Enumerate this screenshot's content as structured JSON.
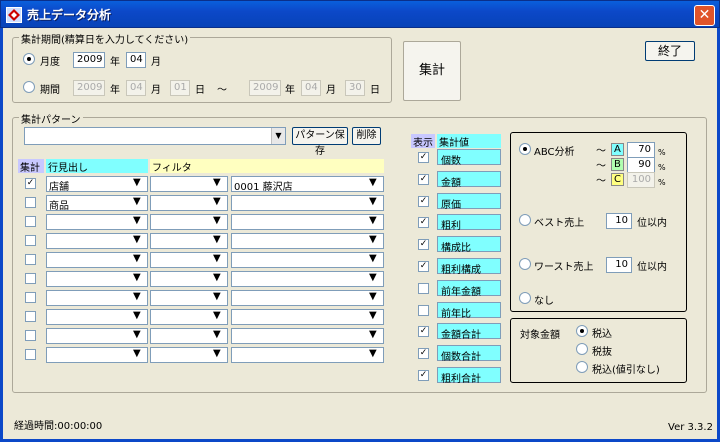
{
  "window": {
    "title": "売上データ分析",
    "close_label": "✕"
  },
  "period": {
    "legend": "集計期間(精算日を入力してください)",
    "monthly": {
      "label": "月度",
      "year": "2009",
      "year_unit": "年",
      "month": "04",
      "month_unit": "月"
    },
    "range": {
      "label": "期間",
      "from_year": "2009",
      "from_month": "04",
      "from_day": "01",
      "tilde": "〜",
      "to_year": "2009",
      "to_month": "04",
      "to_day": "30",
      "year_unit": "年",
      "month_unit": "月",
      "day_unit": "日"
    }
  },
  "aggregate_button": "集計",
  "exit_button": "終了",
  "pattern": {
    "legend": "集計パターン",
    "save_button": "パターン保存",
    "delete_button": "削除",
    "col_aggregate": "集計",
    "col_row_header": "行見出し",
    "col_filter": "フィルタ",
    "rows": [
      {
        "checked": true,
        "row": "店舗",
        "filter": "0001 藤沢店"
      },
      {
        "checked": false,
        "row": "商品",
        "filter": ""
      },
      {
        "checked": false,
        "row": "",
        "filter": ""
      },
      {
        "checked": false,
        "row": "",
        "filter": ""
      },
      {
        "checked": false,
        "row": "",
        "filter": ""
      },
      {
        "checked": false,
        "row": "",
        "filter": ""
      },
      {
        "checked": false,
        "row": "",
        "filter": ""
      },
      {
        "checked": false,
        "row": "",
        "filter": ""
      },
      {
        "checked": false,
        "row": "",
        "filter": ""
      },
      {
        "checked": false,
        "row": "",
        "filter": ""
      }
    ]
  },
  "metrics": {
    "col_display": "表示",
    "col_value": "集計値",
    "items": [
      {
        "checked": true,
        "label": "個数"
      },
      {
        "checked": true,
        "label": "金額"
      },
      {
        "checked": true,
        "label": "原価"
      },
      {
        "checked": true,
        "label": "粗利"
      },
      {
        "checked": true,
        "label": "構成比"
      },
      {
        "checked": true,
        "label": "粗利構成"
      },
      {
        "checked": false,
        "label": "前年金額"
      },
      {
        "checked": false,
        "label": "前年比"
      },
      {
        "checked": true,
        "label": "金額合計"
      },
      {
        "checked": true,
        "label": "個数合計"
      },
      {
        "checked": true,
        "label": "粗利合計"
      }
    ]
  },
  "analysis": {
    "abc": {
      "label": "ABC分析",
      "tilde": "〜",
      "a_label": "A",
      "a_value": "70",
      "b_label": "B",
      "b_value": "90",
      "c_label": "C",
      "c_value": "100",
      "unit": "%"
    },
    "best": {
      "label": "ベスト売上",
      "value": "10",
      "unit": "位以内"
    },
    "worst": {
      "label": "ワースト売上",
      "value": "10",
      "unit": "位以内"
    },
    "none": {
      "label": "なし"
    }
  },
  "amount": {
    "label": "対象金額",
    "options": [
      "税込",
      "税抜",
      "税込(値引なし)"
    ]
  },
  "status": {
    "elapsed": "経過時間:00:00:00",
    "version": "Ver 3.3.2"
  },
  "colors": {
    "title_bar": "#0c48c8",
    "header_cyan": "#80ffff",
    "header_yellow": "#ffffc0"
  }
}
